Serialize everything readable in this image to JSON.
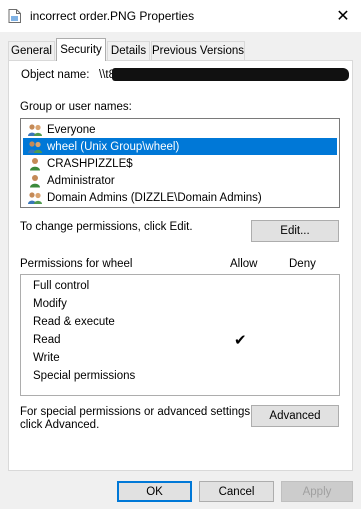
{
  "window": {
    "title": "incorrect order.PNG Properties",
    "close_glyph": "✕"
  },
  "tabs": [
    {
      "label": "General"
    },
    {
      "label": "Security"
    },
    {
      "label": "Details"
    },
    {
      "label": "Previous Versions"
    }
  ],
  "security": {
    "object_name_label": "Object name:",
    "object_name_value": "\\\\t8\\",
    "group_label": "Group or user names:",
    "groups": [
      {
        "name": "Everyone",
        "icon": "group-icon"
      },
      {
        "name": "wheel (Unix Group\\wheel)",
        "icon": "group-icon",
        "selected": true
      },
      {
        "name": "CRASHPIZZLE$",
        "icon": "user-icon"
      },
      {
        "name": "Administrator",
        "icon": "user-icon"
      },
      {
        "name": "Domain Admins (DIZZLE\\Domain Admins)",
        "icon": "group-icon"
      }
    ],
    "change_text": "To change permissions, click Edit.",
    "edit_label": "Edit...",
    "permissions_label": "Permissions for wheel",
    "allow_label": "Allow",
    "deny_label": "Deny",
    "permissions": [
      {
        "name": "Full control",
        "allow": false,
        "deny": false
      },
      {
        "name": "Modify",
        "allow": false,
        "deny": false
      },
      {
        "name": "Read & execute",
        "allow": false,
        "deny": false
      },
      {
        "name": "Read",
        "allow": true,
        "deny": false
      },
      {
        "name": "Write",
        "allow": false,
        "deny": false
      },
      {
        "name": "Special permissions",
        "allow": false,
        "deny": false
      }
    ],
    "check_glyph": "✔",
    "advanced_text_1": "For special permissions or advanced settings,",
    "advanced_text_2": "click Advanced.",
    "advanced_label": "Advanced"
  },
  "footer": {
    "ok_label": "OK",
    "cancel_label": "Cancel",
    "apply_label": "Apply"
  },
  "colors": {
    "selection": "#0078d7",
    "window_bg": "#f0f0f0"
  }
}
